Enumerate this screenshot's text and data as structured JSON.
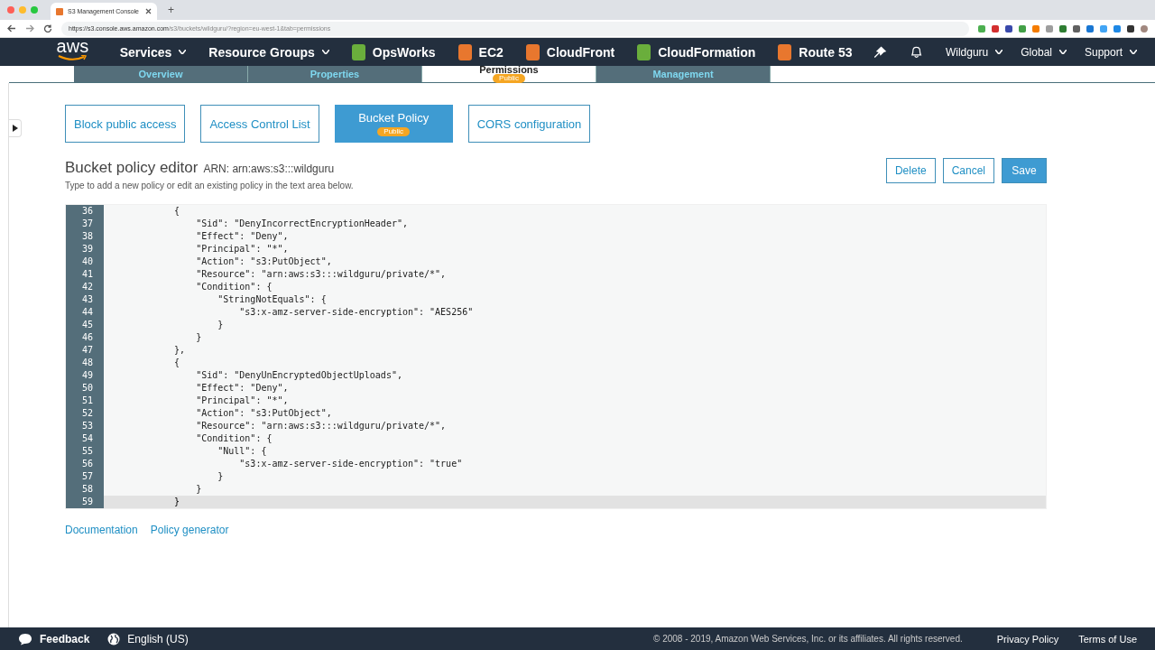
{
  "browser": {
    "tab_title": "S3 Management Console",
    "new_tab": "+",
    "url_host": "https://s3.console.aws.amazon.com",
    "url_path": "/s3/buckets/wildguru/?region=eu-west-1&tab=permissions"
  },
  "nav": {
    "logo": "aws",
    "items": [
      {
        "label": "Services",
        "kind": "menu"
      },
      {
        "label": "Resource Groups",
        "kind": "menu"
      },
      {
        "label": "OpsWorks",
        "kind": "service",
        "color": "#6aae3c"
      },
      {
        "label": "EC2",
        "kind": "service",
        "color": "#e8772e"
      },
      {
        "label": "CloudFront",
        "kind": "service",
        "color": "#e8772e"
      },
      {
        "label": "CloudFormation",
        "kind": "service",
        "color": "#6aae3c"
      },
      {
        "label": "Route 53",
        "kind": "service",
        "color": "#e8772e"
      }
    ],
    "right": [
      {
        "label": "Wildguru"
      },
      {
        "label": "Global"
      },
      {
        "label": "Support"
      }
    ]
  },
  "tabs": [
    {
      "label": "Overview",
      "selected": false
    },
    {
      "label": "Properties",
      "selected": false
    },
    {
      "label": "Permissions",
      "selected": true,
      "badge": "Public"
    },
    {
      "label": "Management",
      "selected": false
    }
  ],
  "subtabs": [
    {
      "label": "Block public access",
      "selected": false
    },
    {
      "label": "Access Control List",
      "selected": false
    },
    {
      "label": "Bucket Policy",
      "selected": true,
      "badge": "Public"
    },
    {
      "label": "CORS configuration",
      "selected": false
    }
  ],
  "editor": {
    "title": "Bucket policy editor",
    "arn": "ARN: arn:aws:s3:::wildguru",
    "hint": "Type to add a new policy or edit an existing policy in the text area below.",
    "buttons": [
      {
        "label": "Delete",
        "kind": "secondary"
      },
      {
        "label": "Cancel",
        "kind": "secondary"
      },
      {
        "label": "Save",
        "kind": "primary"
      }
    ],
    "lines": [
      {
        "number": "36",
        "text": "    {",
        "active": false
      },
      {
        "number": "37",
        "text": "        \"Sid\": \"DenyIncorrectEncryptionHeader\",",
        "active": false
      },
      {
        "number": "38",
        "text": "        \"Effect\": \"Deny\",",
        "active": false
      },
      {
        "number": "39",
        "text": "        \"Principal\": \"*\",",
        "active": false
      },
      {
        "number": "40",
        "text": "        \"Action\": \"s3:PutObject\",",
        "active": false
      },
      {
        "number": "41",
        "text": "        \"Resource\": \"arn:aws:s3:::wildguru/private/*\",",
        "active": false
      },
      {
        "number": "42",
        "text": "        \"Condition\": {",
        "active": false
      },
      {
        "number": "43",
        "text": "            \"StringNotEquals\": {",
        "active": false
      },
      {
        "number": "44",
        "text": "                \"s3:x-amz-server-side-encryption\": \"AES256\"",
        "active": false
      },
      {
        "number": "45",
        "text": "            }",
        "active": false
      },
      {
        "number": "46",
        "text": "        }",
        "active": false
      },
      {
        "number": "47",
        "text": "    },",
        "active": false
      },
      {
        "number": "48",
        "text": "    {",
        "active": false
      },
      {
        "number": "49",
        "text": "        \"Sid\": \"DenyUnEncryptedObjectUploads\",",
        "active": false
      },
      {
        "number": "50",
        "text": "        \"Effect\": \"Deny\",",
        "active": false
      },
      {
        "number": "51",
        "text": "        \"Principal\": \"*\",",
        "active": false
      },
      {
        "number": "52",
        "text": "        \"Action\": \"s3:PutObject\",",
        "active": false
      },
      {
        "number": "53",
        "text": "        \"Resource\": \"arn:aws:s3:::wildguru/private/*\",",
        "active": false
      },
      {
        "number": "54",
        "text": "        \"Condition\": {",
        "active": false
      },
      {
        "number": "55",
        "text": "            \"Null\": {",
        "active": false
      },
      {
        "number": "56",
        "text": "                \"s3:x-amz-server-side-encryption\": \"true\"",
        "active": false
      },
      {
        "number": "57",
        "text": "            }",
        "active": false
      },
      {
        "number": "58",
        "text": "        }",
        "active": false
      },
      {
        "number": "59",
        "text": "    }",
        "active": true
      }
    ],
    "links": [
      "Documentation",
      "Policy generator"
    ]
  },
  "footer": {
    "feedback": "Feedback",
    "language": "English (US)",
    "copyright": "© 2008 - 2019, Amazon Web Services, Inc. or its affiliates. All rights reserved.",
    "links": [
      "Privacy Policy",
      "Terms of Use"
    ]
  }
}
